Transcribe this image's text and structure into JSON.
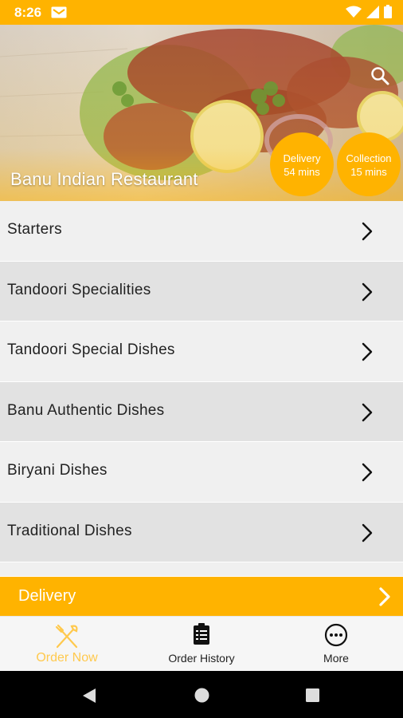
{
  "status_bar": {
    "time": "8:26",
    "icons": [
      "mail-icon",
      "wifi-icon",
      "signal-icon",
      "battery-icon"
    ]
  },
  "header": {
    "restaurant_name": "Banu Indian Restaurant",
    "delivery": {
      "label": "Delivery",
      "time": "54 mins"
    },
    "collection": {
      "label": "Collection",
      "time": "15 mins"
    }
  },
  "menu": {
    "items": [
      {
        "label": "Starters"
      },
      {
        "label": "Tandoori Specialities"
      },
      {
        "label": "Tandoori Special Dishes"
      },
      {
        "label": "Banu Authentic Dishes"
      },
      {
        "label": "Biryani Dishes"
      },
      {
        "label": "Traditional Dishes"
      }
    ]
  },
  "delivery_bar": {
    "label": "Delivery"
  },
  "bottom_nav": {
    "order_now": "Order Now",
    "order_history": "Order History",
    "more": "More"
  },
  "colors": {
    "accent": "#FFB300",
    "row_light": "#F0F0F0",
    "row_dark": "#E2E2E2",
    "active_nav": "#FFC94D"
  }
}
